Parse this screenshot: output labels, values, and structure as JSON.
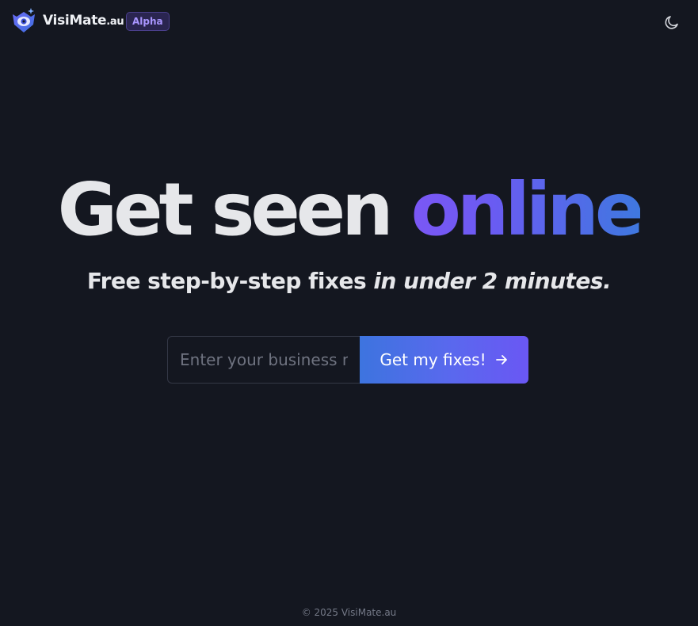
{
  "header": {
    "brand_name": "VisiMate",
    "brand_tld": ".au",
    "badge": "Alpha",
    "logo_icon": "eye-shield-logo",
    "theme_toggle_icon": "moon-icon"
  },
  "hero": {
    "headline_plain": "Get seen ",
    "headline_accent": "online",
    "subline_plain": "Free step-by-step fixes ",
    "subline_italic": "in under 2 minutes."
  },
  "form": {
    "placeholder": "Enter your business name",
    "value": "",
    "submit_label": "Get my fixes!",
    "submit_icon": "arrow-right-icon"
  },
  "footer": {
    "copyright": "© 2025 VisiMate.au"
  },
  "colors": {
    "background": "#141720",
    "accent_purple": "#6a57f4",
    "accent_blue": "#3d74df",
    "badge_text": "#a996ff"
  }
}
